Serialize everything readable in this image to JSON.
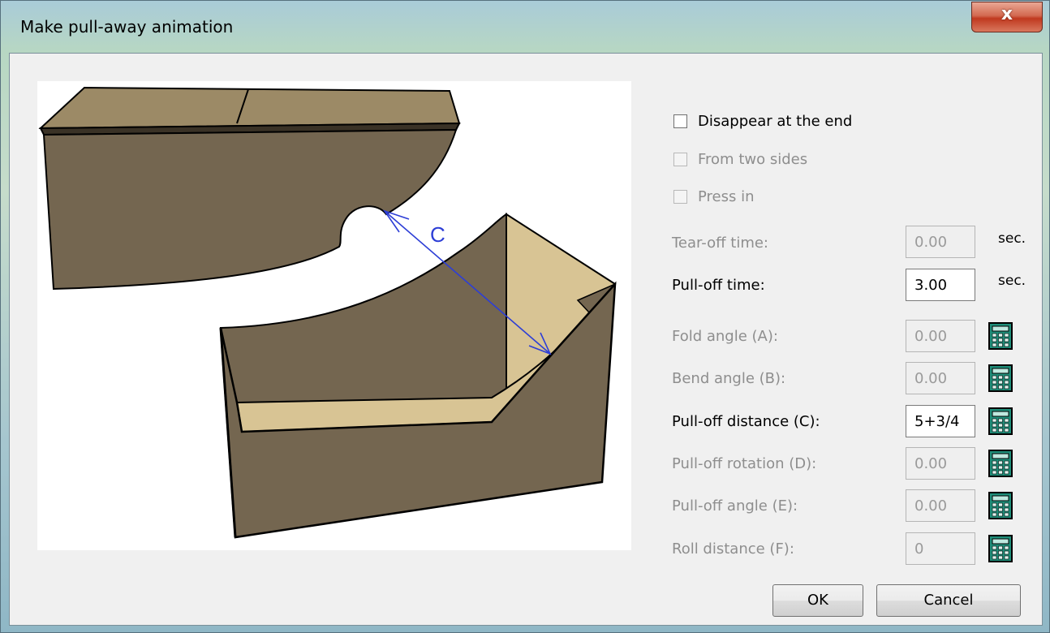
{
  "window": {
    "title": "Make pull-away animation",
    "close_label": "x"
  },
  "illustration": {
    "label_c": "C"
  },
  "options": {
    "disappear": {
      "label": "Disappear at the end",
      "checked": false,
      "enabled": true
    },
    "two_sides": {
      "label": "From two sides",
      "checked": false,
      "enabled": false
    },
    "press_in": {
      "label": "Press in",
      "checked": false,
      "enabled": false
    }
  },
  "fields": [
    {
      "label": "Tear-off time:",
      "value": "0.00",
      "enabled": false,
      "suffix": "sec."
    },
    {
      "label": "Pull-off time:",
      "value": "3.00",
      "enabled": true,
      "suffix": "sec."
    },
    {
      "label": "Fold angle (A):",
      "value": "0.00",
      "enabled": false,
      "calculator": "calculator-icon"
    },
    {
      "label": "Bend angle (B):",
      "value": "0.00",
      "enabled": false,
      "calculator": "calculator-icon"
    },
    {
      "label": "Pull-off distance (C):",
      "value": "5+3/4",
      "enabled": true,
      "calculator": "calculator-icon"
    },
    {
      "label": "Pull-off rotation (D):",
      "value": "0.00",
      "enabled": false,
      "calculator": "calculator-icon"
    },
    {
      "label": "Pull-off angle (E):",
      "value": "0.00",
      "enabled": false,
      "calculator": "calculator-icon"
    },
    {
      "label": "Roll distance (F):",
      "value": "0",
      "enabled": false,
      "calculator": "calculator-icon"
    }
  ],
  "buttons": {
    "ok": "OK",
    "cancel": "Cancel"
  },
  "colors": {
    "cardboard_dark": "#746650",
    "cardboard_light": "#d8c494",
    "cardboard_top": "#9c8a66",
    "dimension_line": "#2d3ed6",
    "calculator": "#1f8f7a"
  }
}
